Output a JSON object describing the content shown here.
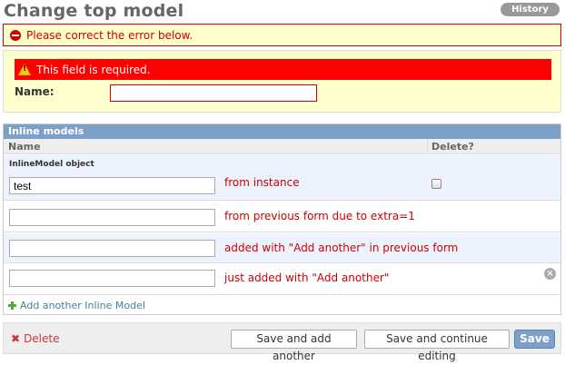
{
  "page": {
    "title": "Change top model",
    "history_label": "History"
  },
  "errornote": {
    "text": "Please correct the error below."
  },
  "name_field": {
    "error": "This field is required.",
    "label": "Name:",
    "value": ""
  },
  "inline": {
    "caption": "Inline models",
    "col_name": "Name",
    "col_delete": "Delete?",
    "object_title": "InlineModel object",
    "rows": [
      {
        "value": "test",
        "note": "from instance"
      },
      {
        "value": "",
        "note": "from previous form due to extra=1"
      },
      {
        "value": "",
        "note": "added with \"Add another\" in previous form"
      },
      {
        "value": "",
        "note": "just added with \"Add another\""
      }
    ],
    "add_label": "Add another Inline Model"
  },
  "submit": {
    "delete_label": "Delete",
    "save_add_label": "Save and add another",
    "save_continue_label": "Save and continue editing",
    "save_label": "Save"
  }
}
